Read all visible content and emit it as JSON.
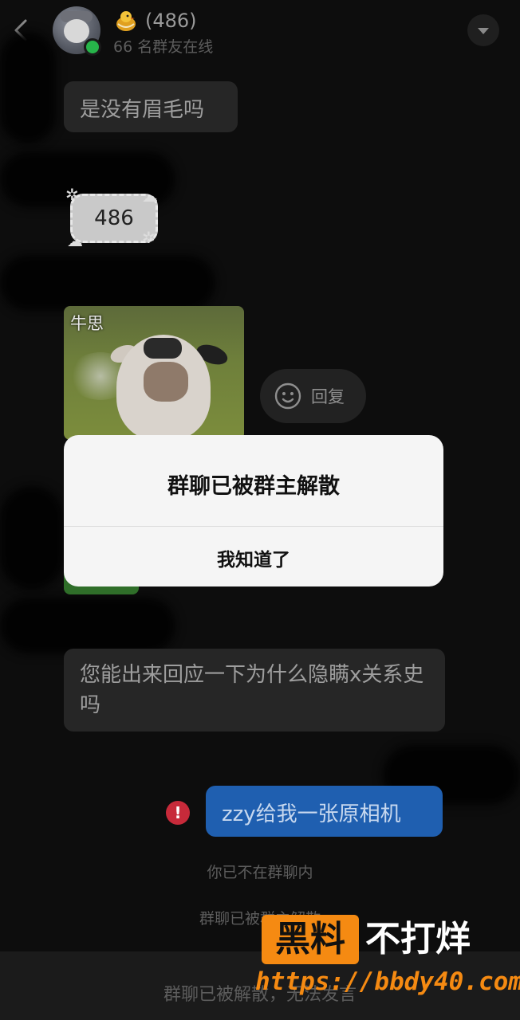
{
  "header": {
    "group_title": "(486)",
    "online_count": "66 名群友在线"
  },
  "messages": {
    "msg1": "是没有眉毛吗",
    "sticker_text": "486",
    "meme_caption": "牛思",
    "reply_label": "回复",
    "msg_long": "您能出来回应一下为什么隐瞒x关系史吗",
    "my_message": "zzy给我一张原相机",
    "fail_mark": "!"
  },
  "system": {
    "not_in_group": "你已不在群聊内",
    "disbanded_note": "群聊已被群主解散",
    "input_disabled": "群聊已被解散，无法发言"
  },
  "dialog": {
    "title": "群聊已被群主解散",
    "confirm": "我知道了"
  },
  "watermark": {
    "brand_main": "黑料",
    "brand_sub": "不打烊",
    "url": "https://bbdy40.com"
  },
  "colors": {
    "bubble_dark": "#262626",
    "my_bubble": "#1f5fb0",
    "online_dot": "#27b44a",
    "fail_red": "#c72a3a",
    "watermark_orange": "#f58a12"
  },
  "icons": [
    "back-icon",
    "chick-icon",
    "chevron-down-icon",
    "smile-icon",
    "error-icon"
  ]
}
